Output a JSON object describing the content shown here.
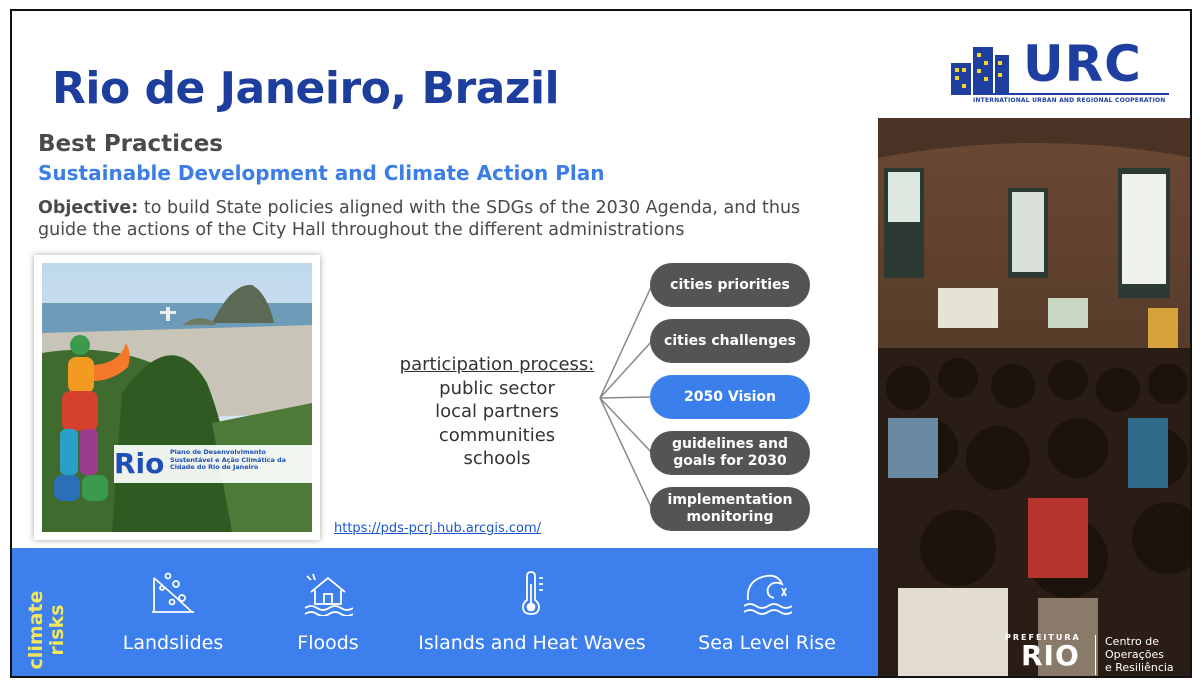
{
  "slide": {
    "title": "Rio de Janeiro, Brazil",
    "logo": {
      "text": "URC",
      "subtitle": "INTERNATIONAL URBAN AND REGIONAL COOPERATION"
    },
    "section": "Best Practices",
    "plan_title": "Sustainable Development and Climate Action Plan",
    "objective_label": "Objective:",
    "objective_text": " to build State policies aligned with the SDGs of the 2030 Agenda, and thus guide the actions of the City Hall throughout the different administrations",
    "cover": {
      "brand": "Rio",
      "caption": "Plano de Desenvolvimento Sustentável e Ação Climática da Cidade do Rio de Janeiro"
    },
    "process": {
      "heading": "participation process:",
      "items": [
        "public sector",
        "local partners",
        "communities",
        "schools"
      ]
    },
    "url": "https://pds-pcrj.hub.arcgis.com/",
    "pills": [
      {
        "label": "cities priorities"
      },
      {
        "label": "cities challenges"
      },
      {
        "label": "2050 Vision"
      },
      {
        "label": "guidelines and goals for 2030"
      },
      {
        "label": "implementation monitoring"
      }
    ],
    "colors": {
      "title": "#1d3e9c",
      "accent": "#3d7fec",
      "pill_gray": "#545454",
      "risk_label": "#f2e75a"
    },
    "risks": {
      "label_line1": "climate",
      "label_line2": "risks",
      "items": [
        {
          "label": "Landslides",
          "icon": "landslide-icon"
        },
        {
          "label": "Floods",
          "icon": "flood-house-icon"
        },
        {
          "label": "Islands and Heat Waves",
          "icon": "thermometer-icon"
        },
        {
          "label": "Sea Level Rise",
          "icon": "wave-icon"
        }
      ]
    },
    "prefeitura": {
      "small": "PREFEITURA",
      "city": "RIO",
      "desc_line1": "Centro de",
      "desc_line2": "Operações",
      "desc_line3": "e Resiliência"
    }
  }
}
